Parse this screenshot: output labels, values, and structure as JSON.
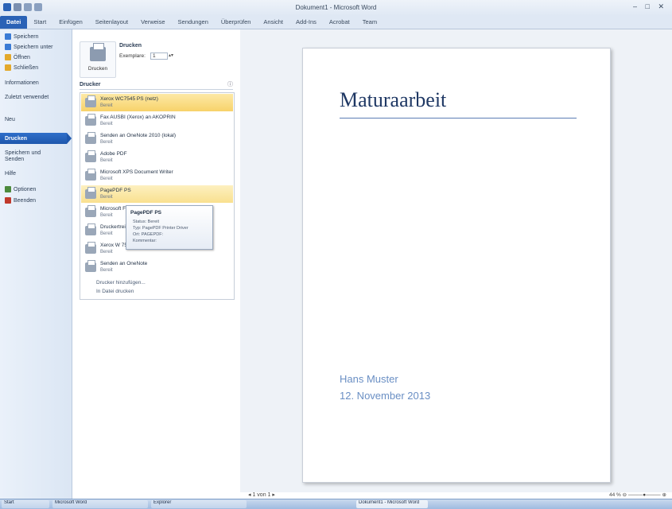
{
  "window": {
    "title": "Dokument1 - Microsoft Word",
    "controls": "–  □  ✕"
  },
  "tabs": [
    "Datei",
    "Start",
    "Einfügen",
    "Seitenlayout",
    "Verweise",
    "Sendungen",
    "Überprüfen",
    "Ansicht",
    "Add-Ins",
    "Acrobat",
    "Team"
  ],
  "nav": {
    "items": [
      {
        "label": "Speichern",
        "icon": "save-icon",
        "color": "#3a7bd5"
      },
      {
        "label": "Speichern unter",
        "icon": "save-as-icon",
        "color": "#3a7bd5"
      },
      {
        "label": "Öffnen",
        "icon": "open-folder-icon",
        "color": "#e3a92b"
      },
      {
        "label": "Schließen",
        "icon": "close-document-icon",
        "color": "#e3a92b"
      },
      {
        "label": "Informationen",
        "icon": "",
        "color": ""
      },
      {
        "label": "Zuletzt verwendet",
        "icon": "",
        "color": ""
      },
      {
        "label": "Neu",
        "icon": "",
        "color": ""
      },
      {
        "label": "Drucken",
        "icon": "",
        "color": ""
      },
      {
        "label": "Speichern und Senden",
        "icon": "",
        "color": ""
      },
      {
        "label": "Hilfe",
        "icon": "",
        "color": ""
      },
      {
        "label": "Optionen",
        "icon": "options-icon",
        "color": "#4c8a3c"
      },
      {
        "label": "Beenden",
        "icon": "exit-icon",
        "color": "#c0392b"
      }
    ],
    "selected": "Drucken"
  },
  "print": {
    "section_heading": "Drucken",
    "button_label": "Drucken",
    "copies_label": "Exemplare:",
    "copies_value": "1",
    "printer_heading": "Drucker",
    "printers": [
      {
        "name": "Xerox WC7545 PS (netz)",
        "status": "Bereit"
      },
      {
        "name": "Fax AUSBI (Xerox) an AKOPRIN",
        "status": "Bereit"
      },
      {
        "name": "Senden an OneNote 2010 (lokal)",
        "status": "Bereit"
      },
      {
        "name": "Adobe PDF",
        "status": "Bereit"
      },
      {
        "name": "Microsoft XPS Document Writer",
        "status": "Bereit"
      },
      {
        "name": "PagePDF PS",
        "status": "Bereit"
      },
      {
        "name": "Microsoft Fax",
        "status": "Bereit"
      },
      {
        "name": "Druckertreiber",
        "status": "Bereit"
      },
      {
        "name": "Xerox W 7545",
        "status": "Bereit"
      },
      {
        "name": "Senden an OneNote",
        "status": "Bereit"
      }
    ],
    "links": [
      "Drucker hinzufügen...",
      "In Datei drucken"
    ]
  },
  "tooltip": {
    "title": "PagePDF PS",
    "lines": [
      "Status: Bereit",
      "Typ: PagePDF Printer Driver",
      "Ort: PAGEPDF:",
      "Kommentar:"
    ]
  },
  "document": {
    "title": "Maturaarbeit",
    "author": "Hans Muster",
    "date": "12. November 2013"
  },
  "status": {
    "pager": "◂  1   von 1  ▸",
    "zoom": "44 %  ⊖ ────●──── ⊕"
  },
  "taskbar": [
    "Start",
    "Microsoft Word",
    "Explorer",
    "Dokument1 - Microsoft Word"
  ]
}
